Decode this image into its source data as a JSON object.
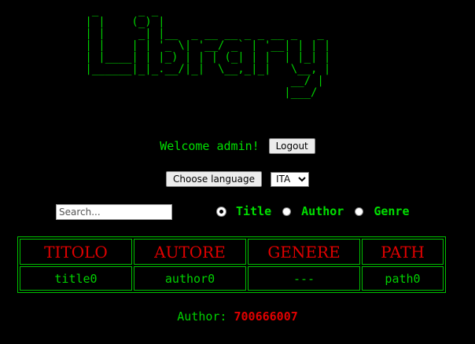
{
  "logo": {
    "text": "  _      _ _                          \n | |    (_) |                         \n | |     _| |__  _ __ __ _ _ __ _   _ \n | |    | | '_ \\| '__/ _` | '__| | | |\n | |____| | |_) | | | (_| | |  | |_| |\n |______|_|_.__/|_|  \\__,_|_|   \\__, |\n                                __/ |\n                               |___/ "
  },
  "header": {
    "welcome": "Welcome admin!",
    "logout_label": "Logout"
  },
  "language": {
    "button_label": "Choose language",
    "selected": "ITA"
  },
  "search": {
    "placeholder": "Search..."
  },
  "filters": [
    {
      "label": "Title",
      "checked": true
    },
    {
      "label": "Author",
      "checked": false
    },
    {
      "label": "Genre",
      "checked": false
    }
  ],
  "table": {
    "headers": [
      "TITOLO",
      "AUTORE",
      "GENERE",
      "PATH"
    ],
    "rows": [
      [
        "title0",
        "author0",
        "---",
        "path0"
      ]
    ]
  },
  "footer": {
    "label": "Author:",
    "value": "700666007"
  },
  "colors": {
    "background": "#000000",
    "text_green": "#00e000",
    "header_red": "#e00000"
  }
}
